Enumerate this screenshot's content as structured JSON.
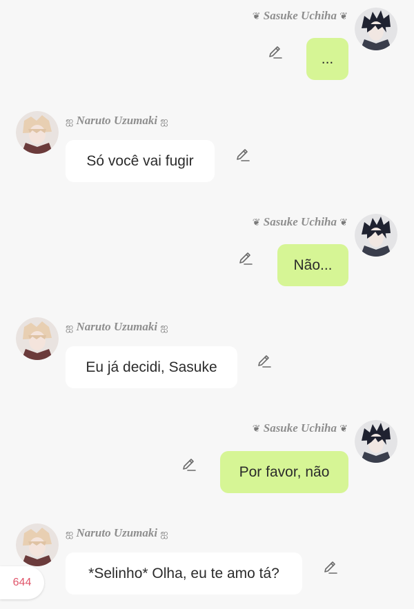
{
  "messages": [
    {
      "side": "right",
      "name": "Sasuke Uchiha",
      "name_ornament": "❦",
      "text": "..."
    },
    {
      "side": "left",
      "name": "Naruto Uzumaki",
      "name_ornament": "ஐ",
      "text": "Só você vai fugir"
    },
    {
      "side": "right",
      "name": "Sasuke Uchiha",
      "name_ornament": "❦",
      "text": "Não..."
    },
    {
      "side": "left",
      "name": "Naruto Uzumaki",
      "name_ornament": "ஐ",
      "text": "Eu já decidi, Sasuke"
    },
    {
      "side": "right",
      "name": "Sasuke Uchiha",
      "name_ornament": "❦",
      "text": "Por favor, não"
    },
    {
      "side": "left",
      "name": "Naruto Uzumaki",
      "name_ornament": "ஐ",
      "text": "*Selinho* Olha, eu te amo tá?"
    }
  ],
  "counter": "644",
  "icons": {
    "edit": "pencil-edit-icon",
    "sasuke_avatar": "sasuke-avatar",
    "naruto_avatar": "naruto-avatar"
  },
  "colors": {
    "background": "#f7f7f7",
    "my_bubble": "#d6f595",
    "their_bubble": "#ffffff",
    "name_text": "#8e8e8e",
    "counter_text": "#e0556a"
  }
}
